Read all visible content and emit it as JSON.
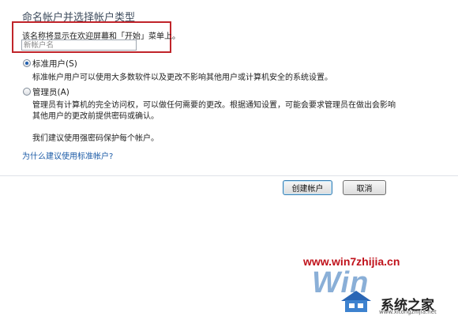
{
  "dialog": {
    "heading": "命名帐户并选择帐户类型",
    "name_hint": "该名称将显示在欢迎屏幕和「开始」菜单上。",
    "name_placeholder": "新帐户名",
    "options": [
      {
        "label": "标准用户(S)",
        "checked": true,
        "desc": [
          "标准帐户用户可以使用大多数软件以及更改不影响其他用户或计算机安全的系统设置。"
        ]
      },
      {
        "label": "管理员(A)",
        "checked": false,
        "desc": [
          "管理员有计算机的完全访问权，可以做任何需要的更改。根据通知设置，可能会要求管理员在做出会影响",
          "其他用户的更改前提供密码或确认。"
        ]
      }
    ],
    "recommend_note": "我们建议使用强密码保护每个帐户。",
    "help_link": "为什么建议使用标准帐户?",
    "buttons": {
      "create": "创建帐户",
      "cancel": "取消"
    }
  },
  "watermark": {
    "url": "www.win7zhijia.cn",
    "win_text": "Win",
    "logo_text": "系统之家",
    "site_text": "www.xitongzhijia.net"
  },
  "colors": {
    "highlight_box": "#c0242a",
    "link": "#1a5aa6",
    "watermark_url": "#c0121b"
  }
}
